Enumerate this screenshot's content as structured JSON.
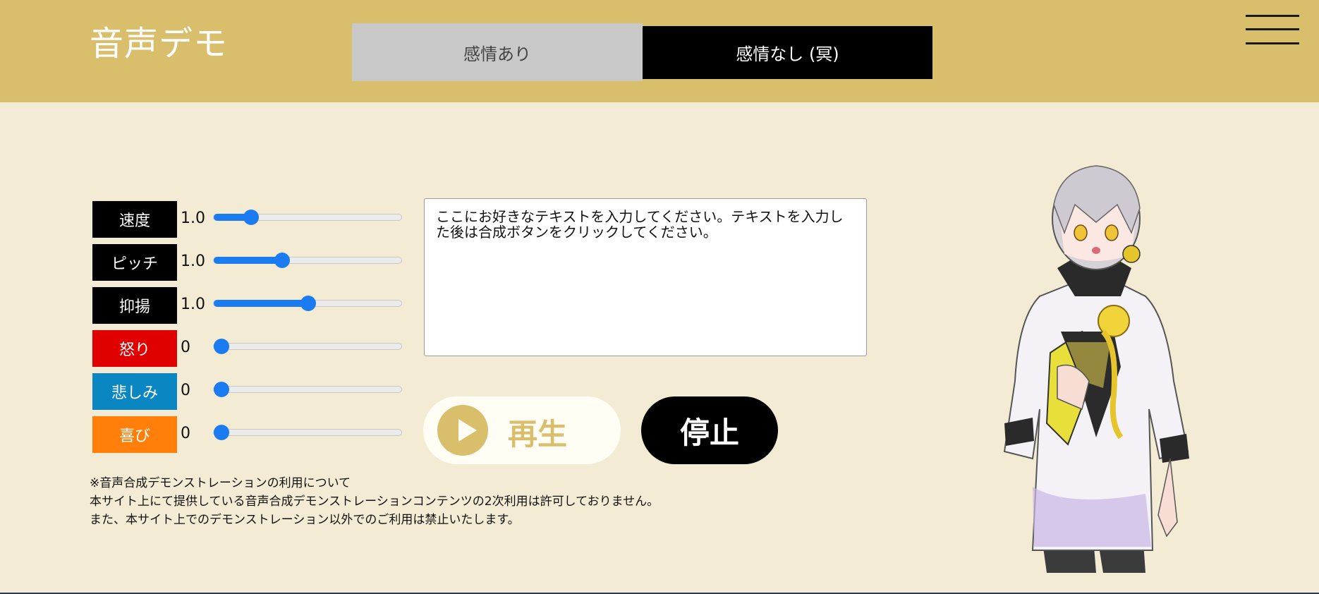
{
  "header": {
    "title": "音声デモ",
    "tabs": [
      {
        "label": "感情あり",
        "active": false
      },
      {
        "label": "感情なし (冥)",
        "active": true
      }
    ],
    "menu_icon": "hamburger-menu-icon"
  },
  "sliders": [
    {
      "label": "速度",
      "value": "1.0",
      "level": 0.17,
      "color": "#000000"
    },
    {
      "label": "ピッチ",
      "value": "1.0",
      "level": 0.35,
      "color": "#000000"
    },
    {
      "label": "抑揚",
      "value": "1.0",
      "level": 0.5,
      "color": "#000000"
    },
    {
      "label": "怒り",
      "value": "0",
      "level": 0.0,
      "color": "#e00000"
    },
    {
      "label": "悲しみ",
      "value": "0",
      "level": 0.0,
      "color": "#0a86c3"
    },
    {
      "label": "喜び",
      "value": "0",
      "level": 0.0,
      "color": "#ff7f0a"
    }
  ],
  "text_input": {
    "value": "ここにお好きなテキストを入力してください。テキストを入力した後は合成ボタンをクリックしてください。"
  },
  "buttons": {
    "play_label": "再生",
    "play_icon": "play-icon",
    "stop_label": "停止"
  },
  "notice": {
    "line1": "※音声合成デモンストレーションの利用について",
    "line2": "本サイト上にて提供している音声合成デモンストレーションコンテンツの2次利用は許可しておりません。",
    "line3": "また、本サイト上でのデモンストレーション以外でのご利用は禁止いたします。"
  },
  "colors": {
    "header_bg": "#d9be6c",
    "page_bg": "#f3ebd3",
    "slider_accent": "#1a7cf0"
  }
}
